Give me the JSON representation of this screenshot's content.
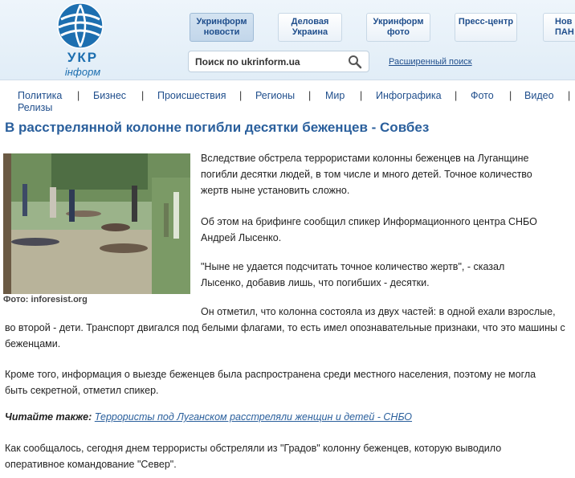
{
  "logo": {
    "line1": "УКР",
    "line2": "інформ"
  },
  "nav": {
    "tabs": [
      {
        "label": "Укринформ новости"
      },
      {
        "label": "Деловая Украина"
      },
      {
        "label": "Укринформ фото"
      },
      {
        "label": "Пресс-центр"
      },
      {
        "label": "Нов ПАН"
      }
    ]
  },
  "search": {
    "placeholder": "Поиск по ukrinform.ua",
    "advanced": "Расширенный поиск"
  },
  "menu": {
    "items": [
      "Политика",
      "Бизнес",
      "Происшествия",
      "Регионы",
      "Мир",
      "Инфографика",
      "Фото",
      "Видео",
      "Релизы"
    ],
    "separator": "|"
  },
  "article": {
    "title": "В расстрелянной колонне погибли десятки беженцев - Совбез",
    "photo_caption": "Фото: inforesist.org",
    "p1": "Вследствие обстрела террористами колонны беженцев на Луганщине погибли десятки людей, в том числе и много детей. Точное количество жертв ныне установить сложно.",
    "p2": "Об этом на брифинге сообщил спикер Информационного центра СНБО Андрей Лысенко.",
    "p3": "\"Ныне не удается подсчитать точное количество жертв\", - сказал Лысенко, добавив лишь, что погибших - десятки.",
    "p4": "Он отметил, что колонна состояла из двух частей: в одной ехали взрослые, во второй - дети. Транспорт двигался под белыми флагами, то есть имел опознавательные признаки, что это машины с беженцами.",
    "p5": "Кроме того, информация о выезде беженцев была распространена среди местного населения, поэтому не могла быть секретной, отметил спикер.",
    "read_also_label": "Читайте также:",
    "read_also_link": "Террористы под Луганском расстреляли женщин и детей - СНБО",
    "p6": "Как сообщалось, сегодня днем террористы обстреляли из \"Градов\" колонну беженцев, которую выводило оперативное командование \"Север\"."
  },
  "colors": {
    "brand": "#1d6fb0",
    "link": "#2a5f9c",
    "nav_text": "#1f4e8c"
  }
}
